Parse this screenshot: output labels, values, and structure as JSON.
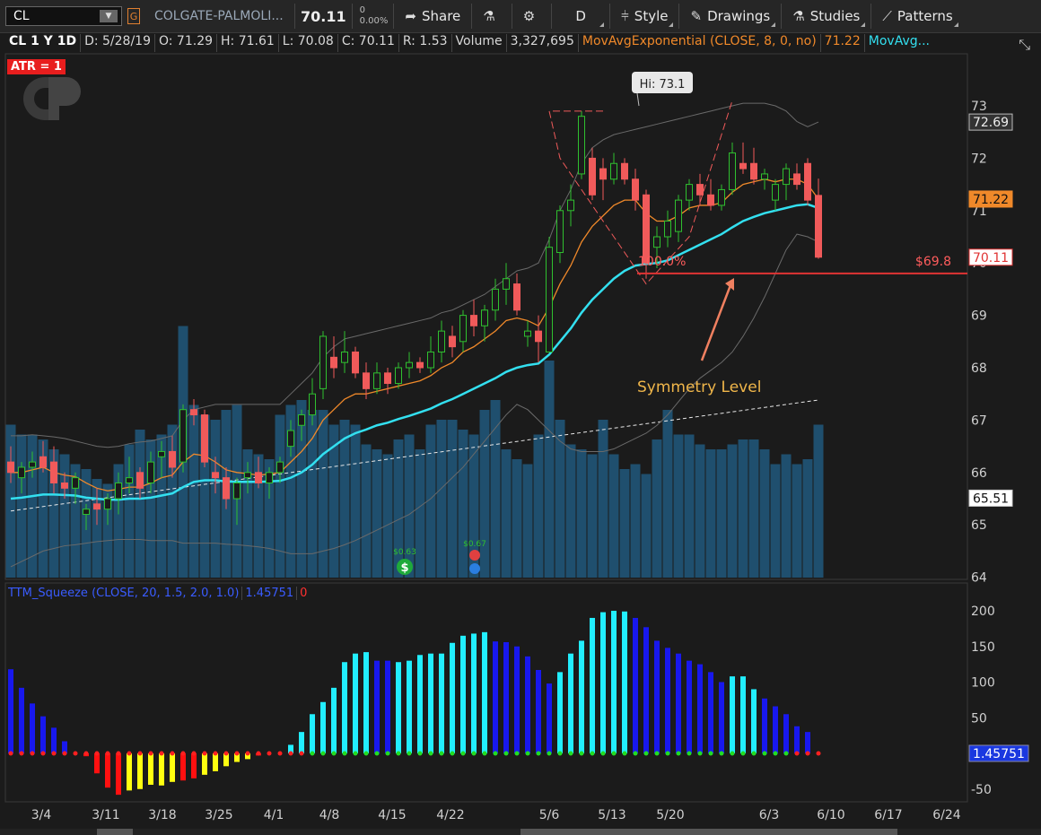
{
  "toolbar": {
    "symbol": "CL",
    "link_label": "G",
    "company": "COLGATE-PALMOLI...",
    "price": "70.11",
    "change": "0",
    "change_pct": "0.00%",
    "share": "Share",
    "timeframe": "D",
    "style": "Style",
    "drawings": "Drawings",
    "studies": "Studies",
    "patterns": "Patterns"
  },
  "info": {
    "symbol_period": "CL 1 Y 1D",
    "date": "D: 5/28/19",
    "open": "O: 71.29",
    "high": "H: 71.61",
    "low": "L: 70.08",
    "close": "C: 70.11",
    "range": "R: 1.53",
    "volume_label": "Volume",
    "volume": "3,327,695",
    "ema8_label": "MovAvgExponential (CLOSE, 8, 0, no)",
    "ema8_value": "71.22",
    "ema21_label": "MovAvg..."
  },
  "atr_label": "ATR = 1",
  "squeeze": {
    "label": "TTM_Squeeze (CLOSE, 20, 1.5, 2.0, 1.0)",
    "value": "1.45751",
    "signal": "0"
  },
  "colors": {
    "up": "#2fc02f",
    "down": "#f05a5a",
    "ema8": "#f0892a",
    "ema21": "#33e0f0",
    "volume": "#1f4f6e",
    "squeeze_cyan": "#22eeff",
    "squeeze_blue": "#1818ee",
    "squeeze_red": "#ff1010",
    "squeeze_yellow": "#ffff10",
    "dot_green": "#22dd22",
    "dot_red": "#ff2020"
  },
  "chart_data": [
    {
      "type": "candlestick",
      "title": "CL 1 Y 1D",
      "ylim": [
        64,
        74
      ],
      "y_ticks": [
        "64",
        "65",
        "66",
        "67",
        "68",
        "69",
        "70",
        "71",
        "72",
        "73"
      ],
      "x_ticks": [
        "3/4",
        "3/11",
        "3/18",
        "3/25",
        "4/1",
        "4/8",
        "4/15",
        "4/22",
        "5/6",
        "5/13",
        "5/20",
        "6/3",
        "6/10",
        "6/17",
        "6/24"
      ],
      "price_labels": [
        {
          "value": 72.69,
          "text": "72.69",
          "style": "dark"
        },
        {
          "value": 71.22,
          "text": "71.22",
          "style": "orange"
        },
        {
          "value": 70.11,
          "text": "70.11",
          "style": "red"
        },
        {
          "value": 65.51,
          "text": "65.51",
          "style": "white"
        }
      ],
      "ohlc": [
        [
          66.2,
          66.5,
          65.8,
          66.0
        ],
        [
          65.9,
          66.2,
          65.6,
          66.1
        ],
        [
          66.1,
          66.4,
          65.9,
          66.2
        ],
        [
          66.3,
          66.6,
          66.0,
          66.1
        ],
        [
          66.2,
          66.5,
          65.6,
          65.8
        ],
        [
          65.8,
          66.0,
          65.5,
          65.7
        ],
        [
          65.7,
          66.0,
          65.4,
          65.9
        ],
        [
          65.2,
          65.4,
          64.9,
          65.3
        ],
        [
          65.4,
          65.7,
          65.0,
          65.3
        ],
        [
          65.3,
          65.6,
          65.0,
          65.5
        ],
        [
          65.5,
          66.0,
          65.2,
          65.8
        ],
        [
          65.8,
          66.3,
          65.6,
          65.9
        ],
        [
          66.0,
          66.1,
          65.5,
          65.7
        ],
        [
          65.8,
          66.4,
          65.6,
          66.2
        ],
        [
          66.3,
          66.6,
          65.9,
          66.4
        ],
        [
          66.4,
          66.7,
          65.9,
          66.1
        ],
        [
          66.2,
          67.3,
          66.0,
          67.2
        ],
        [
          67.2,
          67.4,
          66.9,
          67.1
        ],
        [
          67.1,
          67.2,
          66.1,
          66.2
        ],
        [
          66.0,
          66.3,
          65.6,
          65.9
        ],
        [
          65.9,
          66.1,
          65.3,
          65.5
        ],
        [
          65.5,
          65.9,
          65.0,
          65.8
        ],
        [
          65.9,
          66.2,
          65.6,
          66.0
        ],
        [
          66.0,
          66.3,
          65.7,
          65.8
        ],
        [
          65.8,
          66.1,
          65.5,
          66.0
        ],
        [
          66.0,
          66.3,
          65.8,
          66.2
        ],
        [
          66.5,
          67.0,
          66.3,
          66.8
        ],
        [
          66.9,
          67.2,
          66.6,
          67.1
        ],
        [
          67.1,
          67.8,
          66.9,
          67.5
        ],
        [
          67.6,
          68.7,
          67.4,
          68.6
        ],
        [
          68.2,
          68.6,
          67.8,
          68.0
        ],
        [
          68.1,
          68.7,
          67.9,
          68.3
        ],
        [
          68.3,
          68.4,
          67.8,
          67.9
        ],
        [
          67.9,
          68.1,
          67.4,
          67.6
        ],
        [
          67.6,
          68.1,
          67.5,
          67.9
        ],
        [
          67.9,
          68.0,
          67.5,
          67.7
        ],
        [
          67.7,
          68.1,
          67.6,
          68.0
        ],
        [
          68.0,
          68.3,
          67.8,
          68.1
        ],
        [
          68.1,
          68.2,
          67.9,
          68.0
        ],
        [
          68.0,
          68.6,
          67.9,
          68.3
        ],
        [
          68.3,
          68.9,
          68.1,
          68.7
        ],
        [
          68.6,
          68.8,
          68.2,
          68.4
        ],
        [
          68.5,
          69.1,
          68.3,
          69.0
        ],
        [
          69.0,
          69.3,
          68.6,
          68.8
        ],
        [
          68.8,
          69.2,
          68.5,
          69.1
        ],
        [
          69.1,
          69.7,
          68.9,
          69.5
        ],
        [
          69.5,
          70.0,
          69.2,
          69.7
        ],
        [
          69.6,
          69.8,
          69.0,
          69.1
        ],
        [
          68.6,
          68.9,
          68.4,
          68.7
        ],
        [
          68.7,
          69.0,
          68.1,
          68.5
        ],
        [
          68.3,
          70.5,
          68.3,
          70.3
        ],
        [
          70.2,
          71.1,
          70.0,
          71.0
        ],
        [
          71.0,
          71.5,
          70.7,
          71.2
        ],
        [
          71.7,
          72.9,
          71.6,
          72.8
        ],
        [
          72.0,
          72.2,
          71.2,
          71.3
        ],
        [
          71.8,
          72.0,
          71.2,
          71.6
        ],
        [
          71.6,
          72.1,
          71.5,
          71.9
        ],
        [
          71.9,
          72.0,
          71.5,
          71.6
        ],
        [
          71.6,
          71.8,
          71.0,
          71.2
        ],
        [
          71.3,
          71.4,
          69.7,
          70.0
        ],
        [
          70.3,
          70.7,
          69.9,
          70.5
        ],
        [
          70.5,
          71.0,
          70.3,
          70.8
        ],
        [
          70.6,
          71.3,
          70.4,
          71.2
        ],
        [
          71.2,
          71.6,
          71.0,
          71.5
        ],
        [
          71.5,
          71.7,
          71.1,
          71.3
        ],
        [
          71.3,
          71.6,
          71.0,
          71.1
        ],
        [
          71.1,
          71.5,
          71.0,
          71.4
        ],
        [
          71.4,
          72.3,
          71.3,
          72.1
        ],
        [
          71.9,
          72.3,
          71.7,
          71.8
        ],
        [
          71.9,
          72.2,
          71.5,
          71.6
        ],
        [
          71.6,
          71.8,
          71.4,
          71.7
        ],
        [
          71.2,
          71.6,
          71.0,
          71.5
        ],
        [
          71.5,
          71.9,
          71.2,
          71.8
        ],
        [
          71.7,
          71.9,
          71.4,
          71.5
        ],
        [
          71.9,
          72.0,
          71.1,
          71.2
        ],
        [
          71.29,
          71.61,
          70.08,
          70.11
        ]
      ],
      "volume_series": [
        3.1,
        2.9,
        2.9,
        2.8,
        2.6,
        2.5,
        2.3,
        2.2,
        2.0,
        1.9,
        2.3,
        2.7,
        3.0,
        2.8,
        2.9,
        3.1,
        5.1,
        3.5,
        3.3,
        3.2,
        3.4,
        3.5,
        2.6,
        2.5,
        2.4,
        3.3,
        3.5,
        3.6,
        3.4,
        3.4,
        3.1,
        3.2,
        3.1,
        2.7,
        2.6,
        2.5,
        2.8,
        2.9,
        2.6,
        3.1,
        3.2,
        3.2,
        3.0,
        2.9,
        3.4,
        3.6,
        2.6,
        2.4,
        2.3,
        2.9,
        4.4,
        3.2,
        2.7,
        2.6,
        2.5,
        3.2,
        2.5,
        2.2,
        2.3,
        2.1,
        2.8,
        3.4,
        2.9,
        2.9,
        2.7,
        2.6,
        2.6,
        2.7,
        2.8,
        2.8,
        2.6,
        2.3,
        2.5,
        2.3,
        2.4,
        3.1
      ],
      "ema8": [
        66.0,
        66.0,
        66.05,
        66.1,
        66.0,
        65.95,
        65.92,
        65.8,
        65.7,
        65.65,
        65.68,
        65.72,
        65.72,
        65.8,
        65.9,
        65.95,
        66.2,
        66.35,
        66.32,
        66.2,
        66.05,
        66.0,
        65.98,
        65.95,
        65.97,
        66.0,
        66.2,
        66.4,
        66.65,
        67.0,
        67.2,
        67.4,
        67.5,
        67.5,
        67.55,
        67.6,
        67.65,
        67.7,
        67.75,
        67.85,
        68.0,
        68.1,
        68.3,
        68.4,
        68.55,
        68.7,
        68.9,
        68.95,
        68.9,
        68.8,
        69.15,
        69.6,
        69.95,
        70.4,
        70.7,
        70.9,
        71.1,
        71.2,
        71.2,
        70.95,
        70.8,
        70.8,
        70.9,
        71.05,
        71.1,
        71.1,
        71.15,
        71.35,
        71.5,
        71.55,
        71.6,
        71.55,
        71.6,
        71.6,
        71.5,
        71.22
      ],
      "ema21": [
        65.5,
        65.52,
        65.55,
        65.58,
        65.58,
        65.57,
        65.56,
        65.52,
        65.5,
        65.48,
        65.48,
        65.5,
        65.5,
        65.52,
        65.56,
        65.6,
        65.72,
        65.82,
        65.85,
        65.85,
        65.83,
        65.82,
        65.82,
        65.82,
        65.83,
        65.84,
        65.9,
        66.0,
        66.15,
        66.35,
        66.5,
        66.65,
        66.75,
        66.82,
        66.9,
        66.95,
        67.02,
        67.08,
        67.15,
        67.22,
        67.32,
        67.4,
        67.5,
        67.6,
        67.7,
        67.8,
        67.92,
        68.0,
        68.05,
        68.08,
        68.25,
        68.5,
        68.75,
        69.05,
        69.3,
        69.5,
        69.7,
        69.85,
        69.95,
        69.98,
        70.0,
        70.05,
        70.15,
        70.25,
        70.35,
        70.45,
        70.55,
        70.68,
        70.8,
        70.88,
        70.95,
        71.0,
        71.05,
        71.1,
        71.12,
        71.05
      ],
      "bb_upper": [
        66.7,
        66.7,
        66.72,
        66.7,
        66.68,
        66.65,
        66.6,
        66.55,
        66.5,
        66.48,
        66.5,
        66.55,
        66.58,
        66.6,
        66.65,
        66.7,
        67.0,
        67.2,
        67.25,
        67.3,
        67.3,
        67.3,
        67.3,
        67.3,
        67.3,
        67.3,
        67.5,
        67.7,
        67.9,
        68.2,
        68.4,
        68.55,
        68.6,
        68.65,
        68.7,
        68.75,
        68.8,
        68.85,
        68.9,
        68.95,
        69.05,
        69.1,
        69.2,
        69.3,
        69.4,
        69.55,
        69.7,
        69.85,
        69.9,
        70.0,
        70.45,
        71.0,
        71.4,
        71.9,
        72.2,
        72.35,
        72.45,
        72.5,
        72.55,
        72.6,
        72.65,
        72.7,
        72.75,
        72.8,
        72.85,
        72.9,
        72.95,
        73.0,
        73.05,
        73.05,
        73.05,
        73.0,
        72.9,
        72.7,
        72.6,
        72.69
      ],
      "bb_lower": [
        64.2,
        64.3,
        64.4,
        64.5,
        64.55,
        64.6,
        64.62,
        64.65,
        64.68,
        64.7,
        64.72,
        64.72,
        64.72,
        64.7,
        64.7,
        64.7,
        64.65,
        64.65,
        64.65,
        64.65,
        64.63,
        64.62,
        64.6,
        64.58,
        64.55,
        64.5,
        64.45,
        64.45,
        64.45,
        64.5,
        64.55,
        64.62,
        64.7,
        64.8,
        64.9,
        65.0,
        65.1,
        65.2,
        65.35,
        65.5,
        65.7,
        65.9,
        66.1,
        66.35,
        66.6,
        66.85,
        67.1,
        67.3,
        67.2,
        67.0,
        66.8,
        66.6,
        66.45,
        66.4,
        66.4,
        66.4,
        66.45,
        66.55,
        66.65,
        66.75,
        66.9,
        67.1,
        67.35,
        67.6,
        67.8,
        67.95,
        68.1,
        68.3,
        68.6,
        68.95,
        69.35,
        69.8,
        70.25,
        70.55,
        70.5,
        70.4
      ],
      "vol_avg": [
        1.35,
        1.38,
        1.41,
        1.44,
        1.47,
        1.5,
        1.53,
        1.56,
        1.59,
        1.62,
        1.65,
        1.68,
        1.71,
        1.74,
        1.77,
        1.8,
        1.83,
        1.86,
        1.89,
        1.92,
        1.95,
        1.98,
        2.01,
        2.04,
        2.07,
        2.1,
        2.13,
        2.16,
        2.19,
        2.22,
        2.25,
        2.28,
        2.31,
        2.34,
        2.37,
        2.4,
        2.43,
        2.46,
        2.49,
        2.52,
        2.55,
        2.58,
        2.61,
        2.64,
        2.67,
        2.7,
        2.73,
        2.76,
        2.79,
        2.82,
        2.85,
        2.88,
        2.91,
        2.94,
        2.97,
        3.0,
        3.03,
        3.06,
        3.09,
        3.12,
        3.15,
        3.18,
        3.21,
        3.24,
        3.27,
        3.3,
        3.33,
        3.36,
        3.39,
        3.42,
        3.45,
        3.48,
        3.51,
        3.54,
        3.57,
        3.6
      ],
      "annotations": [
        {
          "text": "Hi: 73.1",
          "kind": "high-callout"
        },
        {
          "text": "100.0%",
          "kind": "level-label"
        },
        {
          "text": "$69.8",
          "kind": "level-price",
          "value": 69.8
        },
        {
          "text": "Symmetry Level",
          "kind": "note"
        },
        {
          "text": "$0.63",
          "kind": "dividend-marker"
        },
        {
          "text": "$0.67",
          "kind": "earnings-marker"
        }
      ]
    },
    {
      "type": "bar",
      "title": "TTM_Squeeze (CLOSE, 20, 1.5, 2.0, 1.0)",
      "ylim": [
        -60,
        210
      ],
      "y_ticks": [
        "200",
        "150",
        "100",
        "50",
        "-50"
      ],
      "value_label": "1.45751",
      "values": [
        118,
        92,
        70,
        52,
        36,
        17,
        0,
        -4,
        -28,
        -48,
        -58,
        -52,
        -50,
        -44,
        -45,
        -40,
        -38,
        -35,
        -30,
        -25,
        -18,
        -12,
        -8,
        -3,
        0,
        0,
        12,
        30,
        55,
        72,
        92,
        128,
        140,
        142,
        130,
        130,
        128,
        130,
        138,
        140,
        140,
        155,
        165,
        168,
        170,
        157,
        156,
        150,
        136,
        117,
        98,
        114,
        140,
        158,
        190,
        198,
        200,
        199,
        190,
        177,
        158,
        148,
        140,
        130,
        125,
        114,
        100,
        108,
        108,
        90,
        77,
        66,
        55,
        38,
        30,
        0
      ],
      "colors": [
        "blue",
        "blue",
        "blue",
        "blue",
        "blue",
        "blue",
        "red",
        "red",
        "red",
        "red",
        "red",
        "yellow",
        "yellow",
        "yellow",
        "yellow",
        "yellow",
        "red",
        "red",
        "yellow",
        "yellow",
        "yellow",
        "yellow",
        "yellow",
        "red",
        "cyan",
        "cyan",
        "cyan",
        "cyan",
        "cyan",
        "cyan",
        "cyan",
        "cyan",
        "cyan",
        "cyan",
        "blue",
        "blue",
        "cyan",
        "cyan",
        "cyan",
        "cyan",
        "cyan",
        "cyan",
        "cyan",
        "cyan",
        "cyan",
        "blue",
        "blue",
        "blue",
        "blue",
        "blue",
        "blue",
        "cyan",
        "cyan",
        "cyan",
        "cyan",
        "cyan",
        "cyan",
        "cyan",
        "blue",
        "blue",
        "blue",
        "blue",
        "blue",
        "blue",
        "blue",
        "blue",
        "blue",
        "cyan",
        "cyan",
        "cyan",
        "blue",
        "blue",
        "blue",
        "blue",
        "blue",
        "blue"
      ],
      "dots": [
        "red",
        "red",
        "red",
        "red",
        "red",
        "red",
        "red",
        "red",
        "red",
        "red",
        "red",
        "red",
        "red",
        "red",
        "red",
        "red",
        "red",
        "red",
        "red",
        "red",
        "red",
        "red",
        "red",
        "red",
        "red",
        "red",
        "red",
        "red",
        "green",
        "green",
        "green",
        "green",
        "green",
        "green",
        "green",
        "green",
        "green",
        "green",
        "green",
        "green",
        "green",
        "green",
        "green",
        "green",
        "green",
        "green",
        "green",
        "green",
        "green",
        "green",
        "green",
        "green",
        "green",
        "green",
        "green",
        "green",
        "green",
        "green",
        "green",
        "green",
        "green",
        "green",
        "green",
        "green",
        "green",
        "green",
        "green",
        "green",
        "green",
        "green",
        "green",
        "green",
        "green",
        "red",
        "red",
        "red"
      ]
    }
  ]
}
